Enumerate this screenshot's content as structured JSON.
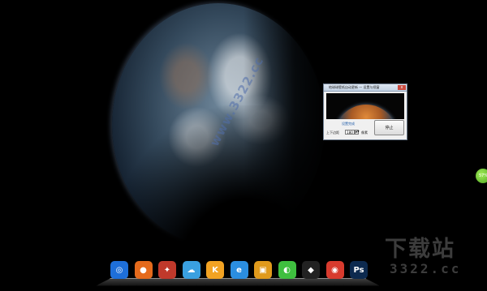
{
  "dialog": {
    "title": "地球球壁纸自动更新 — 设置与视窗",
    "close_label": "x",
    "status": "设置完成",
    "interval_label": "上下边距",
    "interval_value": "180",
    "spinner": "▲▼",
    "unit": "像素",
    "stop_label": "停止"
  },
  "edge_widget": {
    "label": "57%"
  },
  "watermark": {
    "diagonal": "www.3322.cc",
    "cn": "下载站",
    "url": "3322.cc"
  },
  "dock": {
    "icons": [
      {
        "name": "blue-orb-app-icon",
        "glyph": "◎",
        "color": "#1e6fd9"
      },
      {
        "name": "firefox-icon",
        "glyph": "●",
        "color": "#e56a1c"
      },
      {
        "name": "robot-figure-icon",
        "glyph": "✦",
        "color": "#c0392b"
      },
      {
        "name": "cloud-icon",
        "glyph": "☁",
        "color": "#3aa0e0"
      },
      {
        "name": "kingsoft-app-icon",
        "glyph": "K",
        "color": "#f2a323"
      },
      {
        "name": "internet-explorer-icon",
        "glyph": "e",
        "color": "#2b8ee0"
      },
      {
        "name": "app-window-icon",
        "glyph": "▣",
        "color": "#e09a1c"
      },
      {
        "name": "wechat-icon",
        "glyph": "◐",
        "color": "#3fbf3f"
      },
      {
        "name": "qq-penguin-icon",
        "glyph": "◆",
        "color": "#222222"
      },
      {
        "name": "chrome-icon",
        "glyph": "◉",
        "color": "#d83b2e"
      },
      {
        "name": "photoshop-icon",
        "glyph": "Ps",
        "color": "#0d2a4f"
      }
    ]
  }
}
